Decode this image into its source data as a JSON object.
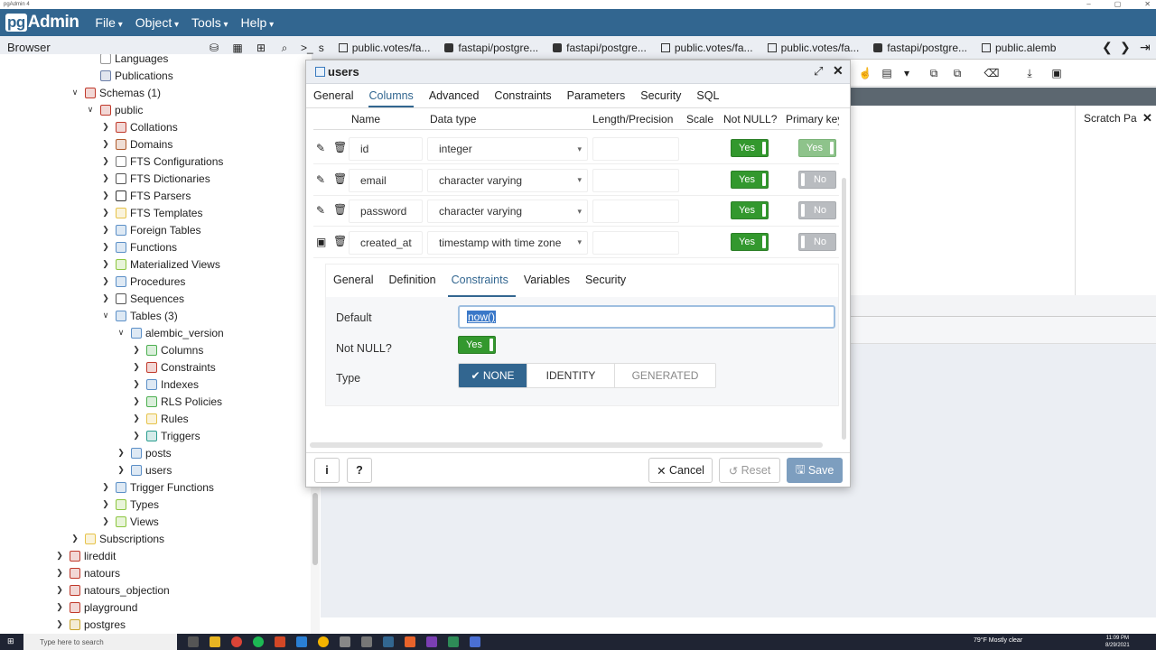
{
  "window": {
    "title": "pgAdmin 4"
  },
  "app": {
    "logo_pg": "pg",
    "logo_rest": "Admin"
  },
  "menu": [
    "File",
    "Object",
    "Tools",
    "Help"
  ],
  "browser": {
    "title": "Browser"
  },
  "tabs": [
    {
      "label": "s",
      "kind": "none"
    },
    {
      "label": "public.votes/fa...",
      "kind": "table"
    },
    {
      "label": "fastapi/postgre...",
      "kind": "db"
    },
    {
      "label": "fastapi/postgre...",
      "kind": "db"
    },
    {
      "label": "public.votes/fa...",
      "kind": "table"
    },
    {
      "label": "public.votes/fa...",
      "kind": "table"
    },
    {
      "label": "fastapi/postgre...",
      "kind": "db"
    },
    {
      "label": "public.alemb",
      "kind": "table"
    }
  ],
  "tree": [
    {
      "label": "Languages",
      "depth": 5,
      "caret": "",
      "color": "#999"
    },
    {
      "label": "Publications",
      "depth": 5,
      "caret": "",
      "color": "#6b7fa8"
    },
    {
      "label": "Schemas (1)",
      "depth": 4,
      "caret": "v",
      "color": "#c0392b"
    },
    {
      "label": "public",
      "depth": 5,
      "caret": "v",
      "color": "#c0392b"
    },
    {
      "label": "Collations",
      "depth": 6,
      "caret": ">",
      "color": "#c0392b"
    },
    {
      "label": "Domains",
      "depth": 6,
      "caret": ">",
      "color": "#b05b2d"
    },
    {
      "label": "FTS Configurations",
      "depth": 6,
      "caret": ">",
      "color": "#777"
    },
    {
      "label": "FTS Dictionaries",
      "depth": 6,
      "caret": ">",
      "color": "#555"
    },
    {
      "label": "FTS Parsers",
      "depth": 6,
      "caret": ">",
      "color": "#333"
    },
    {
      "label": "FTS Templates",
      "depth": 6,
      "caret": ">",
      "color": "#e6c34a"
    },
    {
      "label": "Foreign Tables",
      "depth": 6,
      "caret": ">",
      "color": "#5b8fc7"
    },
    {
      "label": "Functions",
      "depth": 6,
      "caret": ">",
      "color": "#5b8fc7"
    },
    {
      "label": "Materialized Views",
      "depth": 6,
      "caret": ">",
      "color": "#8cc63f"
    },
    {
      "label": "Procedures",
      "depth": 6,
      "caret": ">",
      "color": "#5b8fc7"
    },
    {
      "label": "Sequences",
      "depth": 6,
      "caret": ">",
      "color": "#555"
    },
    {
      "label": "Tables (3)",
      "depth": 6,
      "caret": "v",
      "color": "#5b8fc7"
    },
    {
      "label": "alembic_version",
      "depth": 7,
      "caret": "v",
      "color": "#5b8fc7"
    },
    {
      "label": "Columns",
      "depth": 8,
      "caret": ">",
      "color": "#4caf50"
    },
    {
      "label": "Constraints",
      "depth": 8,
      "caret": ">",
      "color": "#c0392b"
    },
    {
      "label": "Indexes",
      "depth": 8,
      "caret": ">",
      "color": "#5b8fc7"
    },
    {
      "label": "RLS Policies",
      "depth": 8,
      "caret": ">",
      "color": "#4caf50"
    },
    {
      "label": "Rules",
      "depth": 8,
      "caret": ">",
      "color": "#e6c34a"
    },
    {
      "label": "Triggers",
      "depth": 8,
      "caret": ">",
      "color": "#2a9d8f"
    },
    {
      "label": "posts",
      "depth": 7,
      "caret": ">",
      "color": "#5b8fc7"
    },
    {
      "label": "users",
      "depth": 7,
      "caret": ">",
      "color": "#5b8fc7"
    },
    {
      "label": "Trigger Functions",
      "depth": 6,
      "caret": ">",
      "color": "#5b8fc7"
    },
    {
      "label": "Types",
      "depth": 6,
      "caret": ">",
      "color": "#8cc63f"
    },
    {
      "label": "Views",
      "depth": 6,
      "caret": ">",
      "color": "#8cc63f"
    },
    {
      "label": "Subscriptions",
      "depth": 4,
      "caret": ">",
      "color": "#e6c34a"
    },
    {
      "label": "lireddit",
      "depth": 3,
      "caret": ">",
      "color": "#c0392b"
    },
    {
      "label": "natours",
      "depth": 3,
      "caret": ">",
      "color": "#c0392b"
    },
    {
      "label": "natours_objection",
      "depth": 3,
      "caret": ">",
      "color": "#c0392b"
    },
    {
      "label": "playground",
      "depth": 3,
      "caret": ">",
      "color": "#c0392b"
    },
    {
      "label": "postgres",
      "depth": 3,
      "caret": ">",
      "color": "#c9a227"
    }
  ],
  "dialog": {
    "title": "users",
    "tabs": [
      "General",
      "Columns",
      "Advanced",
      "Constraints",
      "Parameters",
      "Security",
      "SQL"
    ],
    "active_tab": "Columns",
    "columns": [
      "Name",
      "Data type",
      "Length/Precision",
      "Scale",
      "Not NULL?",
      "Primary key"
    ],
    "rows": [
      {
        "name": "id",
        "type": "integer",
        "not_null": "Yes",
        "pk": "Yes"
      },
      {
        "name": "email",
        "type": "character varying",
        "not_null": "Yes",
        "pk": "No"
      },
      {
        "name": "password",
        "type": "character varying",
        "not_null": "Yes",
        "pk": "No"
      },
      {
        "name": "created_at",
        "type": "timestamp with time zone",
        "not_null": "Yes",
        "pk": "No"
      }
    ],
    "subtabs": [
      "General",
      "Definition",
      "Constraints",
      "Variables",
      "Security"
    ],
    "active_subtab": "Constraints",
    "default_label": "Default",
    "default_value": "now()",
    "notnull_label": "Not NULL?",
    "notnull_value": "Yes",
    "type_label": "Type",
    "type_options": [
      "NONE",
      "IDENTITY",
      "GENERATED"
    ],
    "type_selected": "NONE",
    "buttons": {
      "info": "i",
      "help": "?",
      "cancel": "Cancel",
      "reset": "Reset",
      "save": "Save"
    }
  },
  "scratch": {
    "label": "Scratch Pa"
  },
  "taskbar": {
    "search": "Type here to search",
    "weather": "79°F  Mostly clear",
    "time": "11:09 PM",
    "date": "8/29/2021"
  }
}
